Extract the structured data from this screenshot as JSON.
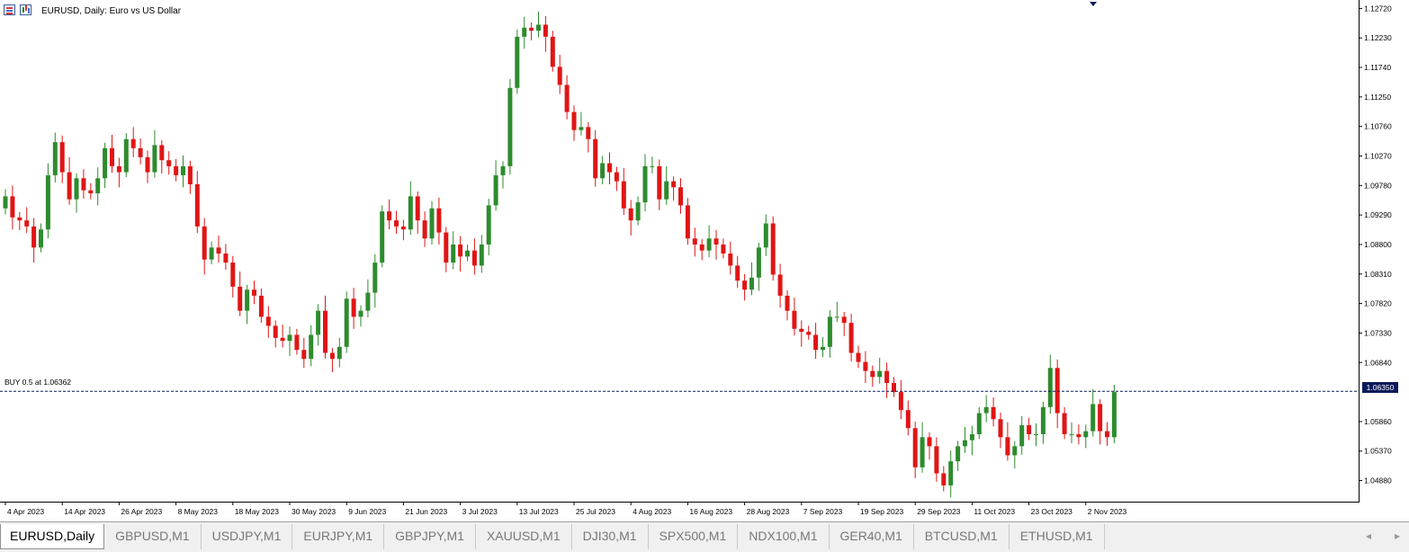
{
  "window": {
    "title": "EURUSD, Daily:  Euro vs US Dollar"
  },
  "icons": [
    "table-icon",
    "chart-icon",
    "down-triangle-marker-icon"
  ],
  "order_line": {
    "label": "BUY 0.5 at 1.06362",
    "price": 1.06362,
    "color": "#0a1a5a"
  },
  "current_price_label": "1.06350",
  "tabs": [
    {
      "label": "EURUSD,Daily",
      "active": true
    },
    {
      "label": "GBPUSD,M1"
    },
    {
      "label": "USDJPY,M1"
    },
    {
      "label": "EURJPY,M1"
    },
    {
      "label": "GBPJPY,M1"
    },
    {
      "label": "XAUUSD,M1"
    },
    {
      "label": "DJI30,M1"
    },
    {
      "label": "SPX500,M1"
    },
    {
      "label": "NDX100,M1"
    },
    {
      "label": "GER40,M1"
    },
    {
      "label": "BTCUSD,M1"
    },
    {
      "label": "ETHUSD,M1"
    }
  ],
  "scroll": {
    "left": "◂",
    "right": "▸"
  },
  "colors": {
    "bull": "#2e8b2e",
    "bear": "#e01515",
    "order_line": "#0a1a5a"
  },
  "chart_data": {
    "type": "candlestick",
    "symbol": "EURUSD",
    "timeframe": "Daily",
    "y_ticks": [
      "1.12720",
      "1.12230",
      "1.11740",
      "1.11250",
      "1.10760",
      "1.10270",
      "1.09780",
      "1.09290",
      "1.08800",
      "1.08310",
      "1.07820",
      "1.07330",
      "1.06840",
      "1.05860",
      "1.05370",
      "1.04880"
    ],
    "ylim": [
      1.0453,
      1.1286
    ],
    "x_ticks": [
      {
        "label": "4 Apr 2023",
        "bar": 0
      },
      {
        "label": "14 Apr 2023",
        "bar": 8
      },
      {
        "label": "26 Apr 2023",
        "bar": 16
      },
      {
        "label": "8 May 2023",
        "bar": 24
      },
      {
        "label": "18 May 2023",
        "bar": 32
      },
      {
        "label": "30 May 2023",
        "bar": 40
      },
      {
        "label": "9 Jun 2023",
        "bar": 48
      },
      {
        "label": "21 Jun 2023",
        "bar": 56
      },
      {
        "label": "3 Jul 2023",
        "bar": 64
      },
      {
        "label": "13 Jul 2023",
        "bar": 72
      },
      {
        "label": "25 Jul 2023",
        "bar": 80
      },
      {
        "label": "4 Aug 2023",
        "bar": 88
      },
      {
        "label": "16 Aug 2023",
        "bar": 96
      },
      {
        "label": "28 Aug 2023",
        "bar": 104
      },
      {
        "label": "7 Sep 2023",
        "bar": 112
      },
      {
        "label": "19 Sep 2023",
        "bar": 120
      },
      {
        "label": "29 Sep 2023",
        "bar": 128
      },
      {
        "label": "11 Oct 2023",
        "bar": 136
      },
      {
        "label": "23 Oct 2023",
        "bar": 144
      },
      {
        "label": "2 Nov 2023",
        "bar": 152
      }
    ],
    "closes": [
      1.096,
      1.0925,
      1.092,
      1.091,
      1.0875,
      1.0905,
      1.0995,
      1.105,
      1.1,
      1.0955,
      1.099,
      1.097,
      1.0965,
      1.099,
      1.104,
      1.101,
      1.1,
      1.1055,
      1.104,
      1.1025,
      1.1,
      1.1045,
      1.102,
      1.101,
      1.0995,
      1.101,
      1.098,
      1.091,
      1.0855,
      1.0875,
      1.0865,
      1.085,
      1.081,
      1.077,
      1.0805,
      1.0795,
      1.076,
      1.0745,
      1.0725,
      1.072,
      1.073,
      1.0705,
      1.069,
      1.073,
      1.077,
      1.07,
      1.069,
      1.071,
      1.079,
      1.076,
      1.077,
      1.08,
      1.085,
      1.0935,
      1.092,
      1.091,
      1.0905,
      1.096,
      1.092,
      1.089,
      1.094,
      1.09,
      1.085,
      1.088,
      1.086,
      1.087,
      1.0845,
      1.088,
      1.0945,
      1.0995,
      1.101,
      1.114,
      1.1225,
      1.124,
      1.1235,
      1.1245,
      1.1225,
      1.1175,
      1.1145,
      1.11,
      1.107,
      1.1075,
      1.1055,
      1.099,
      1.1015,
      1.1,
      1.0985,
      1.094,
      1.092,
      1.095,
      1.101,
      1.101,
      1.0955,
      1.0985,
      1.0975,
      1.0945,
      1.089,
      1.088,
      1.087,
      1.089,
      1.088,
      1.0865,
      1.0845,
      1.082,
      1.0805,
      1.0825,
      1.0875,
      1.0915,
      1.083,
      1.0795,
      1.077,
      1.074,
      1.0735,
      1.073,
      1.0705,
      1.071,
      1.076,
      1.076,
      1.075,
      1.07,
      1.0685,
      1.067,
      1.066,
      1.067,
      1.065,
      1.0635,
      1.0605,
      1.0575,
      1.051,
      1.056,
      1.0545,
      1.05,
      1.048,
      1.052,
      1.0545,
      1.0555,
      1.0565,
      1.06,
      1.061,
      1.059,
      1.056,
      1.053,
      1.0545,
      1.058,
      1.0565,
      1.0565,
      1.061,
      1.0675,
      1.06,
      1.0565,
      1.0565,
      1.056,
      1.057,
      1.0615,
      1.057,
      1.056,
      1.0635
    ],
    "current_price": 1.0635
  }
}
